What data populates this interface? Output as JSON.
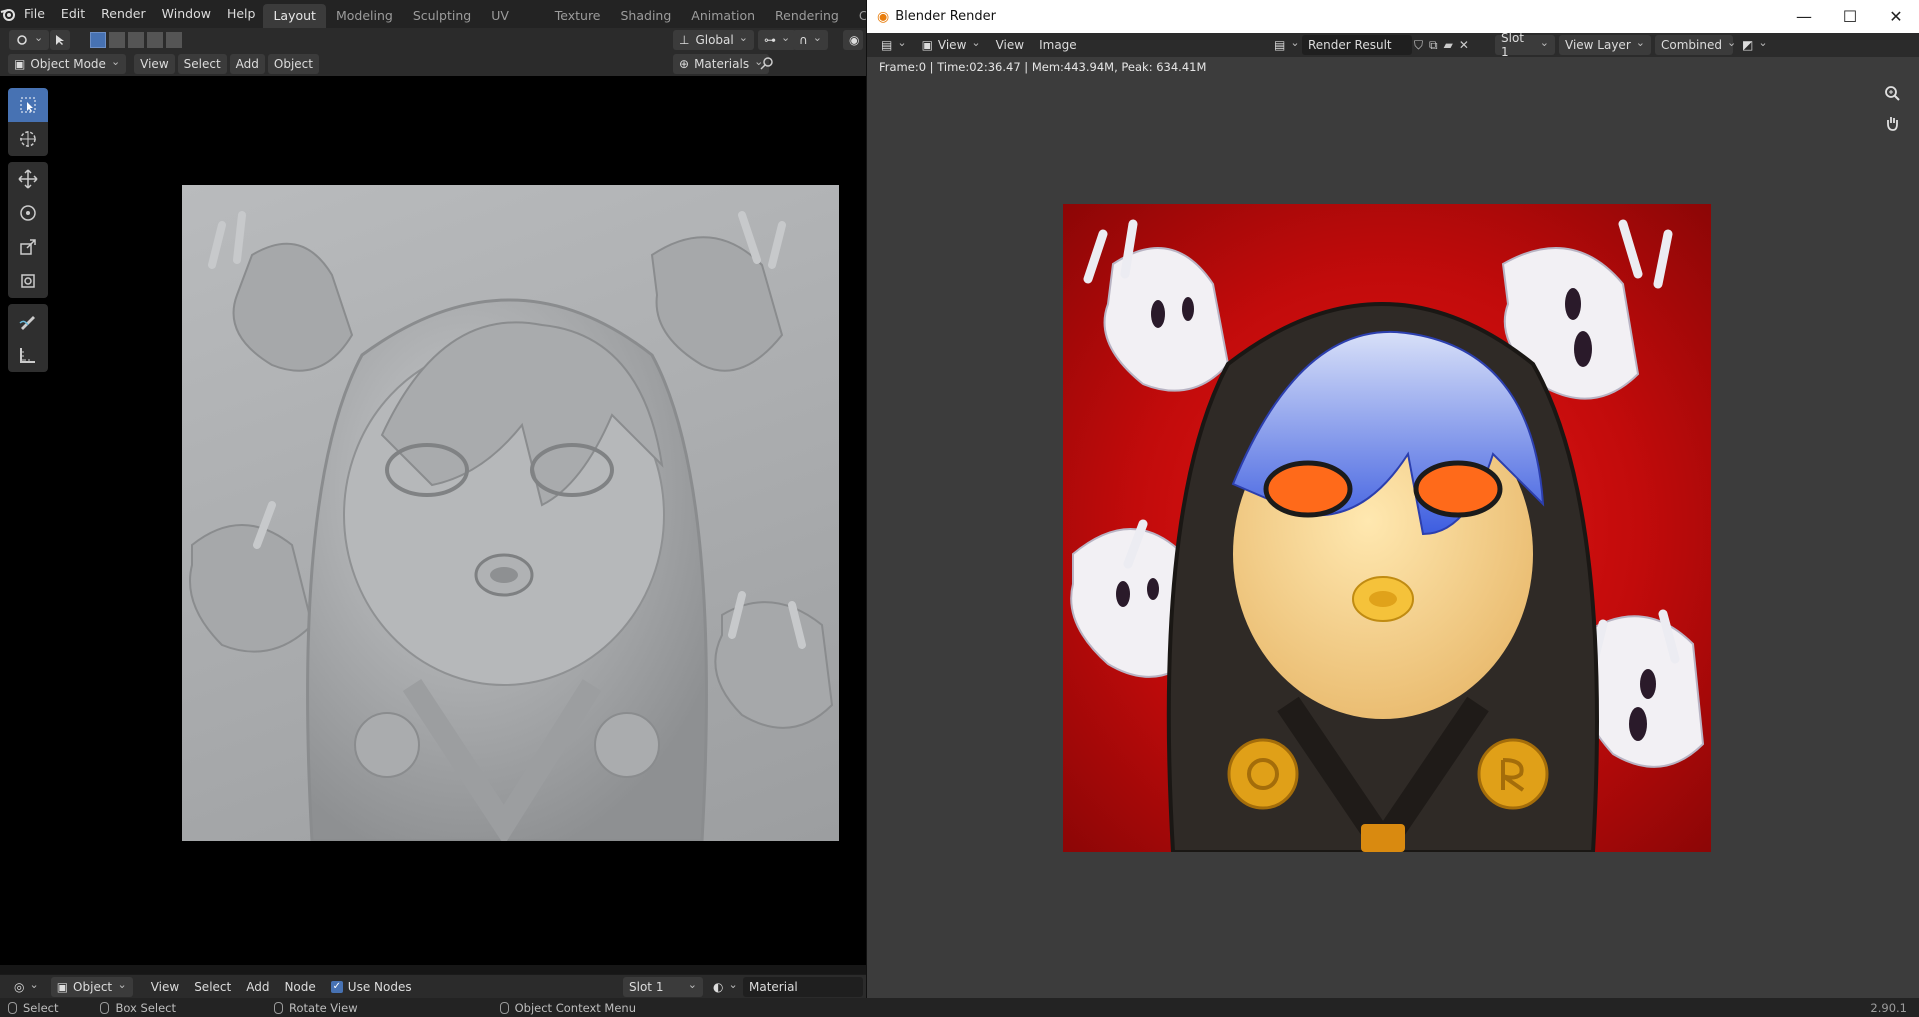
{
  "main_window": {
    "menu": [
      "File",
      "Edit",
      "Render",
      "Window",
      "Help"
    ],
    "workspace_tabs": [
      "Layout",
      "Modeling",
      "Sculpting",
      "UV Editing",
      "Texture Paint",
      "Shading",
      "Animation",
      "Rendering",
      "Compositin"
    ],
    "active_tab": "Layout",
    "transform_orientation": "Global",
    "mode": "Object Mode",
    "viewport_menu": [
      "View",
      "Select",
      "Add",
      "Object"
    ],
    "shading_dropdown": "Materials",
    "node_editor": {
      "type": "Object",
      "menu": [
        "View",
        "Select",
        "Add",
        "Node"
      ],
      "use_nodes_label": "Use Nodes",
      "use_nodes_checked": true,
      "slot": "Slot 1",
      "material": "Material"
    }
  },
  "render_window": {
    "title": "Blender Render",
    "view_dropdown": "View",
    "menu": [
      "View",
      "Image"
    ],
    "image_name": "Render Result",
    "slot": "Slot 1",
    "view_layer": "View Layer",
    "pass": "Combined",
    "info": "Frame:0 | Time:02:36.47 | Mem:443.94M, Peak: 634.41M"
  },
  "status_bar": {
    "items": [
      "Select",
      "Box Select",
      "Rotate View",
      "Object Context Menu"
    ],
    "version": "2.90.1"
  },
  "colors": {
    "accent": "#4772b3",
    "render_background": "#d41010",
    "sculpt_clay": "#b0b2b4"
  }
}
